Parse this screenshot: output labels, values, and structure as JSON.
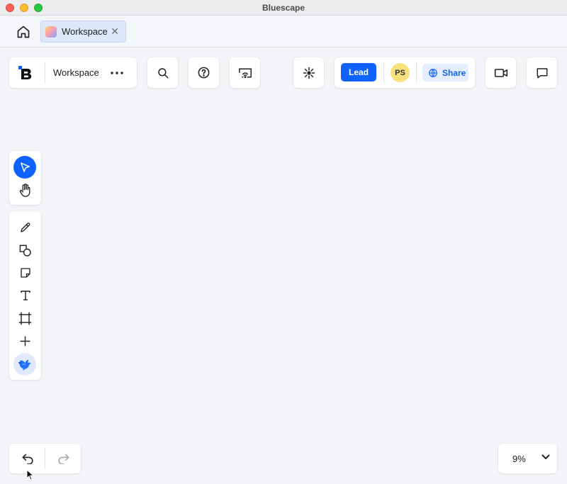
{
  "window": {
    "title": "Bluescape"
  },
  "tabs": [
    {
      "label": "Workspace"
    }
  ],
  "toolbar": {
    "workspace_name": "Workspace",
    "lead_label": "Lead",
    "avatar_initials": "PS",
    "share_label": "Share"
  },
  "zoom": {
    "value": "9%"
  },
  "colors": {
    "accent": "#0f62fe",
    "avatar_bg": "#f8e07d",
    "share_bg": "#e3edfd",
    "canvas_bg": "#f3f4f8"
  },
  "icons": {
    "home": "home-icon",
    "menu": "more-horizontal-icon",
    "search": "search-icon",
    "help": "help-circle-icon",
    "cast": "screen-cast-icon",
    "spark": "spark-icon",
    "share": "globe-icon",
    "video": "video-camera-icon",
    "chat": "chat-bubble-icon",
    "select": "pointer-icon",
    "pan": "hand-icon",
    "pen": "pencil-icon",
    "shapes": "shapes-icon",
    "note": "sticky-note-icon",
    "text": "text-icon",
    "frame": "frame-icon",
    "add": "plus-icon",
    "assistant": "bird-icon",
    "undo": "undo-icon",
    "redo": "redo-icon",
    "zoom_menu": "chevron-down-icon"
  }
}
